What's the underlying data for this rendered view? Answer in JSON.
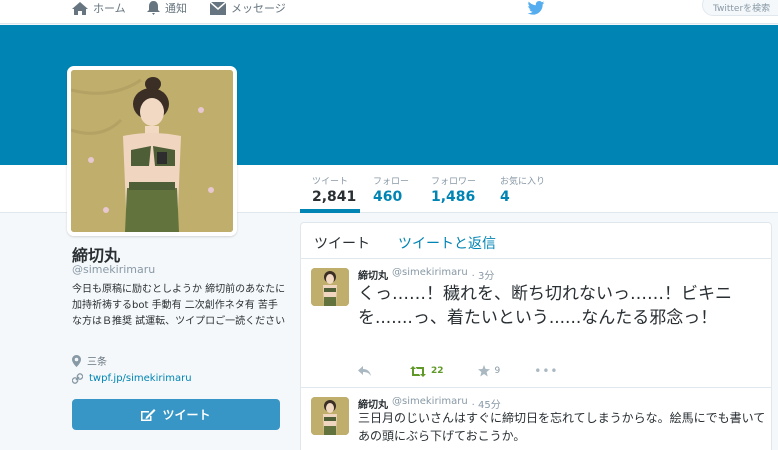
{
  "nav": {
    "home": "ホーム",
    "notifications": "通知",
    "messages": "メッセージ",
    "search_placeholder": "Twitterを検索"
  },
  "colors": {
    "banner": "#0084b4",
    "accent": "#0084b4",
    "button": "#3796c5",
    "retweet": "#609928"
  },
  "stats": {
    "tweets_label": "ツイート",
    "tweets_value": "2,841",
    "following_label": "フォロー",
    "following_value": "460",
    "followers_label": "フォロワー",
    "followers_value": "1,486",
    "favorites_label": "お気に入り",
    "favorites_value": "4"
  },
  "profile": {
    "name": "締切丸",
    "handle": "@simekirimaru",
    "bio": "今日も原稿に励むとしようか 締切前のあなたに加持祈祷するbot 手動有 二次創作ネタ有 苦手な方はＢ推奨 試運転、ツイプロご一読ください",
    "location": "三条",
    "url": "twpf.jp/simekirimaru",
    "tweet_button": "ツイート"
  },
  "timeline": {
    "tabs": [
      "ツイート",
      "ツイートと返信"
    ],
    "tweets": [
      {
        "name": "締切丸",
        "handle": "@simekirimaru",
        "time": "· 3分",
        "text": "くっ……！穢れを、断ち切れないっ……！ビキニを.......っ、着たいという......なんたる邪念っ！",
        "retweets": "22",
        "favorites": "9",
        "more": "•••"
      },
      {
        "name": "締切丸",
        "handle": "@simekirimaru",
        "time": "· 45分",
        "text": "三日月のじいさんはすぐに締切日を忘れてしまうからな。絵馬にでも書いてあの頭にぶら下げておこうか。"
      }
    ]
  }
}
